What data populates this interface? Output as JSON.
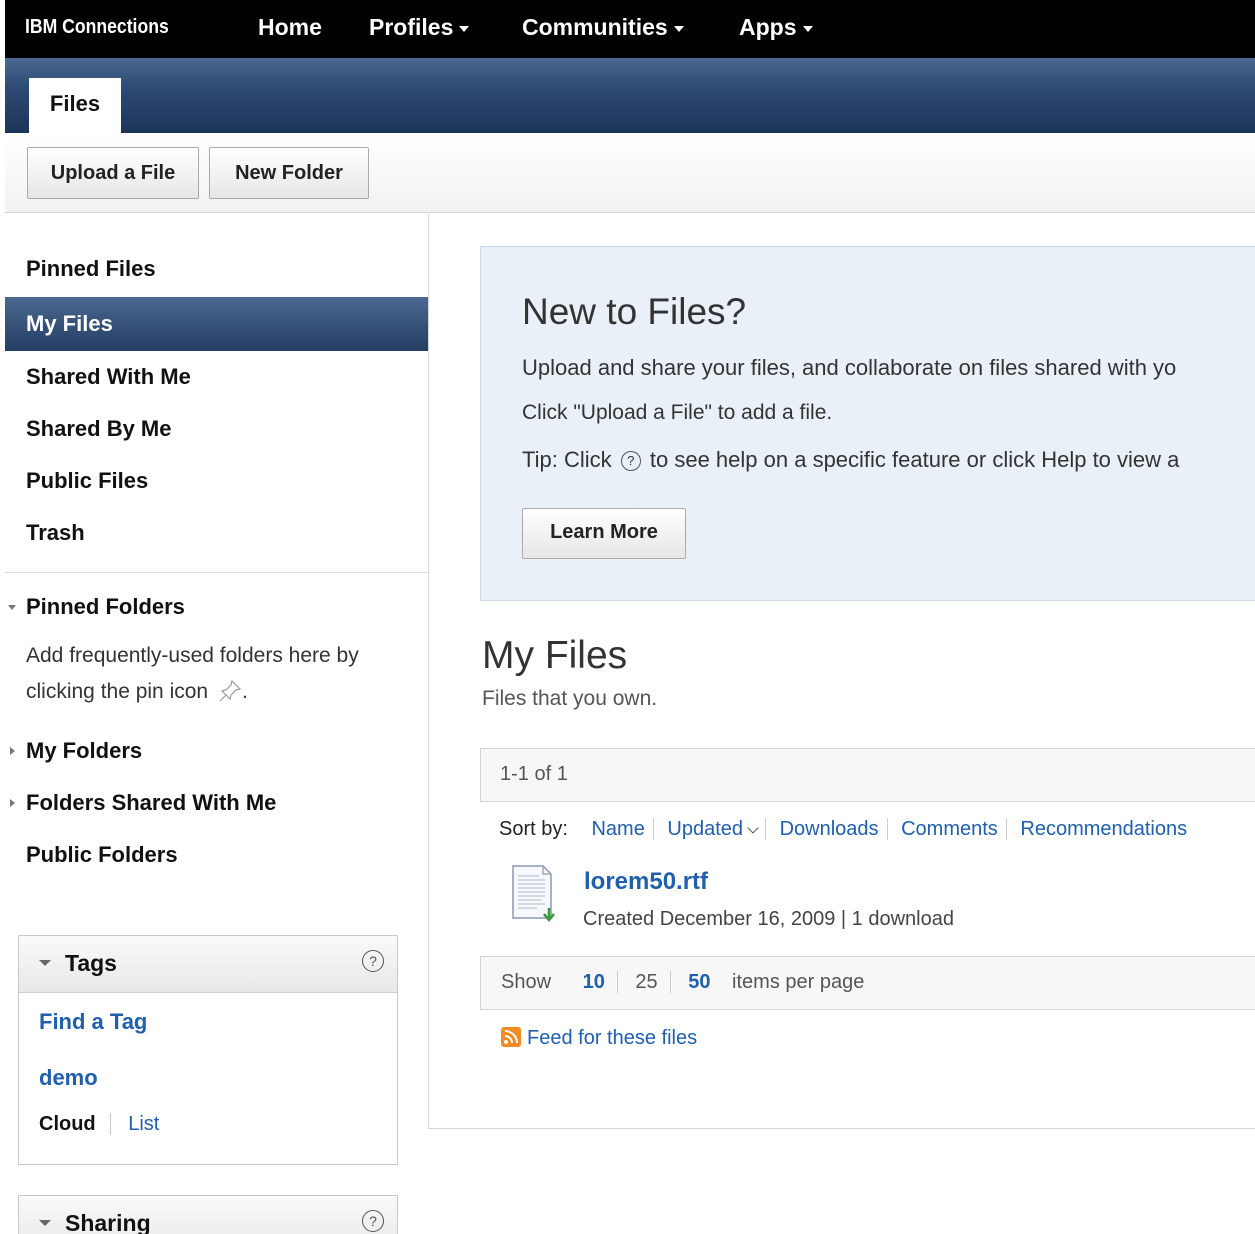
{
  "topbar": {
    "brand": "IBM Connections",
    "nav": [
      {
        "label": "Home",
        "dropdown": false
      },
      {
        "label": "Profiles",
        "dropdown": true
      },
      {
        "label": "Communities",
        "dropdown": true
      },
      {
        "label": "Apps",
        "dropdown": true
      }
    ]
  },
  "tabs": {
    "active": "Files"
  },
  "toolbar": {
    "upload_label": "Upload a File",
    "new_folder_label": "New Folder"
  },
  "sidebar": {
    "items": [
      {
        "label": "Pinned Files",
        "selected": false
      },
      {
        "label": "My Files",
        "selected": true
      },
      {
        "label": "Shared With Me",
        "selected": false
      },
      {
        "label": "Shared By Me",
        "selected": false
      },
      {
        "label": "Public Files",
        "selected": false
      },
      {
        "label": "Trash",
        "selected": false
      }
    ],
    "pinned_folders": {
      "label": "Pinned Folders",
      "hint": "Add frequently-used folders here by clicking the pin icon"
    },
    "folders": {
      "my_folders": "My Folders",
      "shared_with_me": "Folders Shared With Me",
      "public": "Public Folders"
    },
    "tags_widget": {
      "title": "Tags",
      "find_tag": "Find a Tag",
      "tag": "demo",
      "view_cloud": "Cloud",
      "view_list": "List"
    },
    "sharing_widget": {
      "title": "Sharing"
    }
  },
  "promo": {
    "title": "New to Files?",
    "line1": "Upload and share your files, and collaborate on files shared with yo",
    "line2": "Click \"Upload a File\" to add a file.",
    "tip_prefix": "Tip: Click",
    "tip_suffix": "to see help on a specific feature or click Help to view a",
    "learn_more": "Learn More"
  },
  "main": {
    "title": "My Files",
    "subtitle": "Files that you own.",
    "range": "1-1 of 1",
    "sort_label": "Sort by:",
    "sort_options": [
      "Name",
      "Updated",
      "Downloads",
      "Comments",
      "Recommendations"
    ],
    "files": [
      {
        "name": "lorem50.rtf",
        "meta": "Created December 16, 2009 | 1 download"
      }
    ],
    "pager": {
      "show": "Show",
      "sizes": [
        "10",
        "25",
        "50"
      ],
      "suffix": "items per page"
    },
    "feed": "Feed for these files"
  },
  "colors": {
    "link": "#1f5fae",
    "selected_nav": "#2e4a73",
    "promo_bg": "#eaf0f8"
  }
}
